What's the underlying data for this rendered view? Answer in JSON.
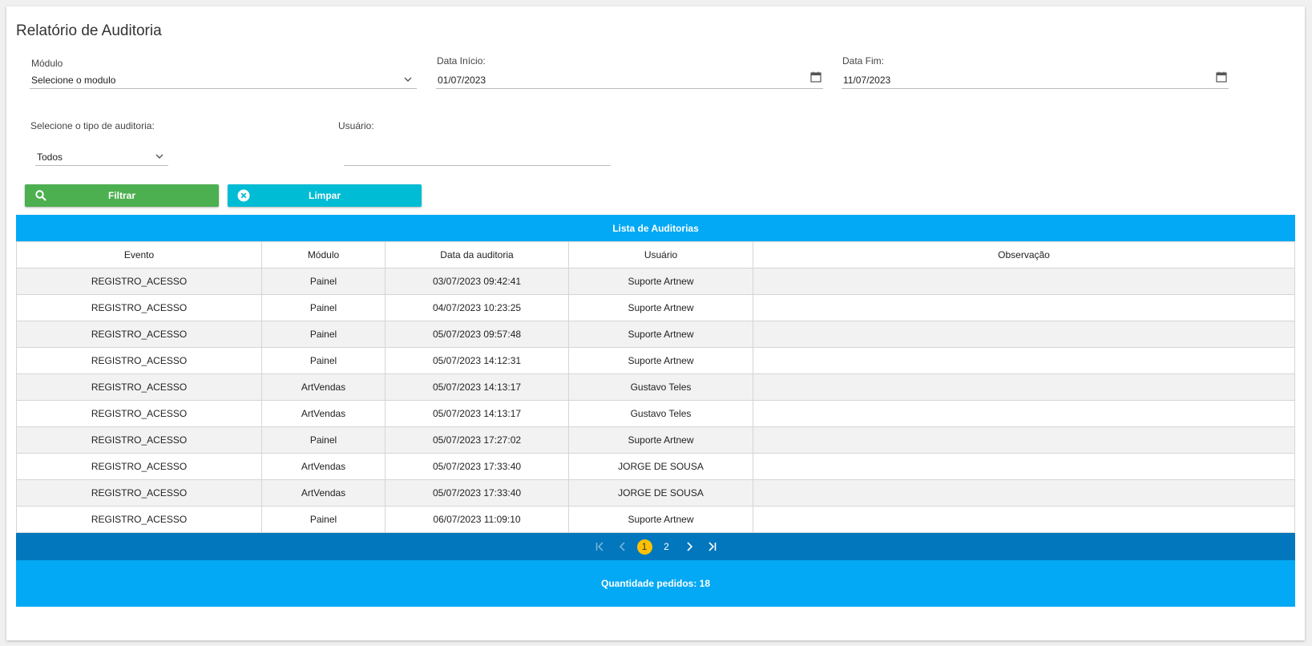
{
  "page": {
    "title": "Relatório de Auditoria"
  },
  "filters": {
    "modulo_label": "Módulo",
    "modulo_value": "Selecione o modulo",
    "data_inicio_label": "Data Início:",
    "data_inicio_value": "01/07/2023",
    "data_fim_label": "Data Fim:",
    "data_fim_value": "11/07/2023",
    "tipo_label": "Selecione o tipo de auditoria:",
    "tipo_value": "Todos",
    "usuario_label": "Usuário:",
    "usuario_value": ""
  },
  "buttons": {
    "filtrar": "Filtrar",
    "limpar": "Limpar"
  },
  "grid": {
    "title": "Lista de Auditorias",
    "columns": [
      "Evento",
      "Módulo",
      "Data da auditoria",
      "Usuário",
      "Observação"
    ],
    "rows": [
      [
        "REGISTRO_ACESSO",
        "Painel",
        "03/07/2023 09:42:41",
        "Suporte Artnew",
        ""
      ],
      [
        "REGISTRO_ACESSO",
        "Painel",
        "04/07/2023 10:23:25",
        "Suporte Artnew",
        ""
      ],
      [
        "REGISTRO_ACESSO",
        "Painel",
        "05/07/2023 09:57:48",
        "Suporte Artnew",
        ""
      ],
      [
        "REGISTRO_ACESSO",
        "Painel",
        "05/07/2023 14:12:31",
        "Suporte Artnew",
        ""
      ],
      [
        "REGISTRO_ACESSO",
        "ArtVendas",
        "05/07/2023 14:13:17",
        "Gustavo Teles",
        ""
      ],
      [
        "REGISTRO_ACESSO",
        "ArtVendas",
        "05/07/2023 14:13:17",
        "Gustavo Teles",
        ""
      ],
      [
        "REGISTRO_ACESSO",
        "Painel",
        "05/07/2023 17:27:02",
        "Suporte Artnew",
        ""
      ],
      [
        "REGISTRO_ACESSO",
        "ArtVendas",
        "05/07/2023 17:33:40",
        "JORGE DE SOUSA",
        ""
      ],
      [
        "REGISTRO_ACESSO",
        "ArtVendas",
        "05/07/2023 17:33:40",
        "JORGE DE SOUSA",
        ""
      ],
      [
        "REGISTRO_ACESSO",
        "Painel",
        "06/07/2023 11:09:10",
        "Suporte Artnew",
        ""
      ]
    ],
    "pager": {
      "pages": [
        "1",
        "2"
      ],
      "current": "1"
    },
    "footer": "Quantidade pedidos: 18"
  },
  "colors": {
    "green": "#4caf50",
    "cyan": "#00bcd4",
    "header_blue": "#03a9f4",
    "pager_blue": "#0277bd",
    "active_page": "#ffc107"
  }
}
